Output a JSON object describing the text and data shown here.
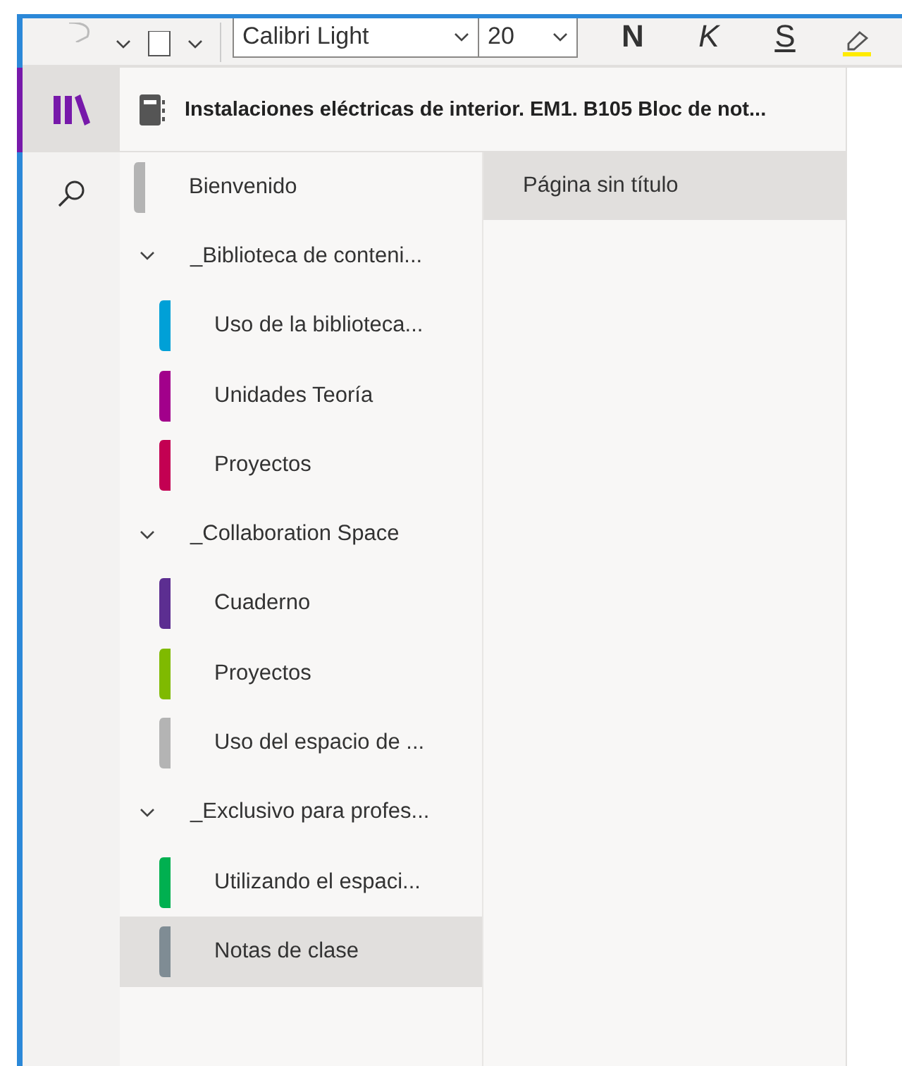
{
  "toolbar": {
    "font": "Calibri Light",
    "size": "20",
    "format_buttons": [
      {
        "label": "N",
        "kind": "bold"
      },
      {
        "label": "K",
        "kind": "italic"
      },
      {
        "label": "S",
        "kind": "underline"
      }
    ]
  },
  "nav": [
    {
      "kind": "library",
      "selected": true
    },
    {
      "kind": "search",
      "selected": false
    }
  ],
  "notebook": {
    "title": "Instalaciones eléctricas de interior. EM1. B105 Bloc de not..."
  },
  "sections": [
    {
      "kind": "section",
      "label": "Bienvenido",
      "color": "#b4b4b4",
      "selected": false
    },
    {
      "kind": "group",
      "label": "_Biblioteca de conteni...",
      "expanded": true,
      "children": [
        {
          "kind": "section",
          "label": "Uso de la biblioteca...",
          "color": "#00a0d7",
          "selected": false
        },
        {
          "kind": "section",
          "label": "Unidades Teoría",
          "color": "#a2008b",
          "selected": false
        },
        {
          "kind": "section",
          "label": "Proyectos",
          "color": "#c30052",
          "selected": false
        }
      ]
    },
    {
      "kind": "group",
      "label": "_Collaboration Space",
      "expanded": true,
      "children": [
        {
          "kind": "section",
          "label": "Cuaderno",
          "color": "#5c2e91",
          "selected": false
        },
        {
          "kind": "section",
          "label": "Proyectos",
          "color": "#7fba00",
          "selected": false
        },
        {
          "kind": "section",
          "label": "Uso del espacio de ...",
          "color": "#b4b4b4",
          "selected": false
        }
      ]
    },
    {
      "kind": "group",
      "label": "_Exclusivo para profes...",
      "expanded": true,
      "children": [
        {
          "kind": "section",
          "label": "Utilizando el espaci...",
          "color": "#00b050",
          "selected": false
        },
        {
          "kind": "section",
          "label": "Notas de clase",
          "color": "#7f8c94",
          "selected": true
        }
      ]
    }
  ],
  "pages": [
    {
      "title": "Página sin título",
      "selected": true
    }
  ]
}
